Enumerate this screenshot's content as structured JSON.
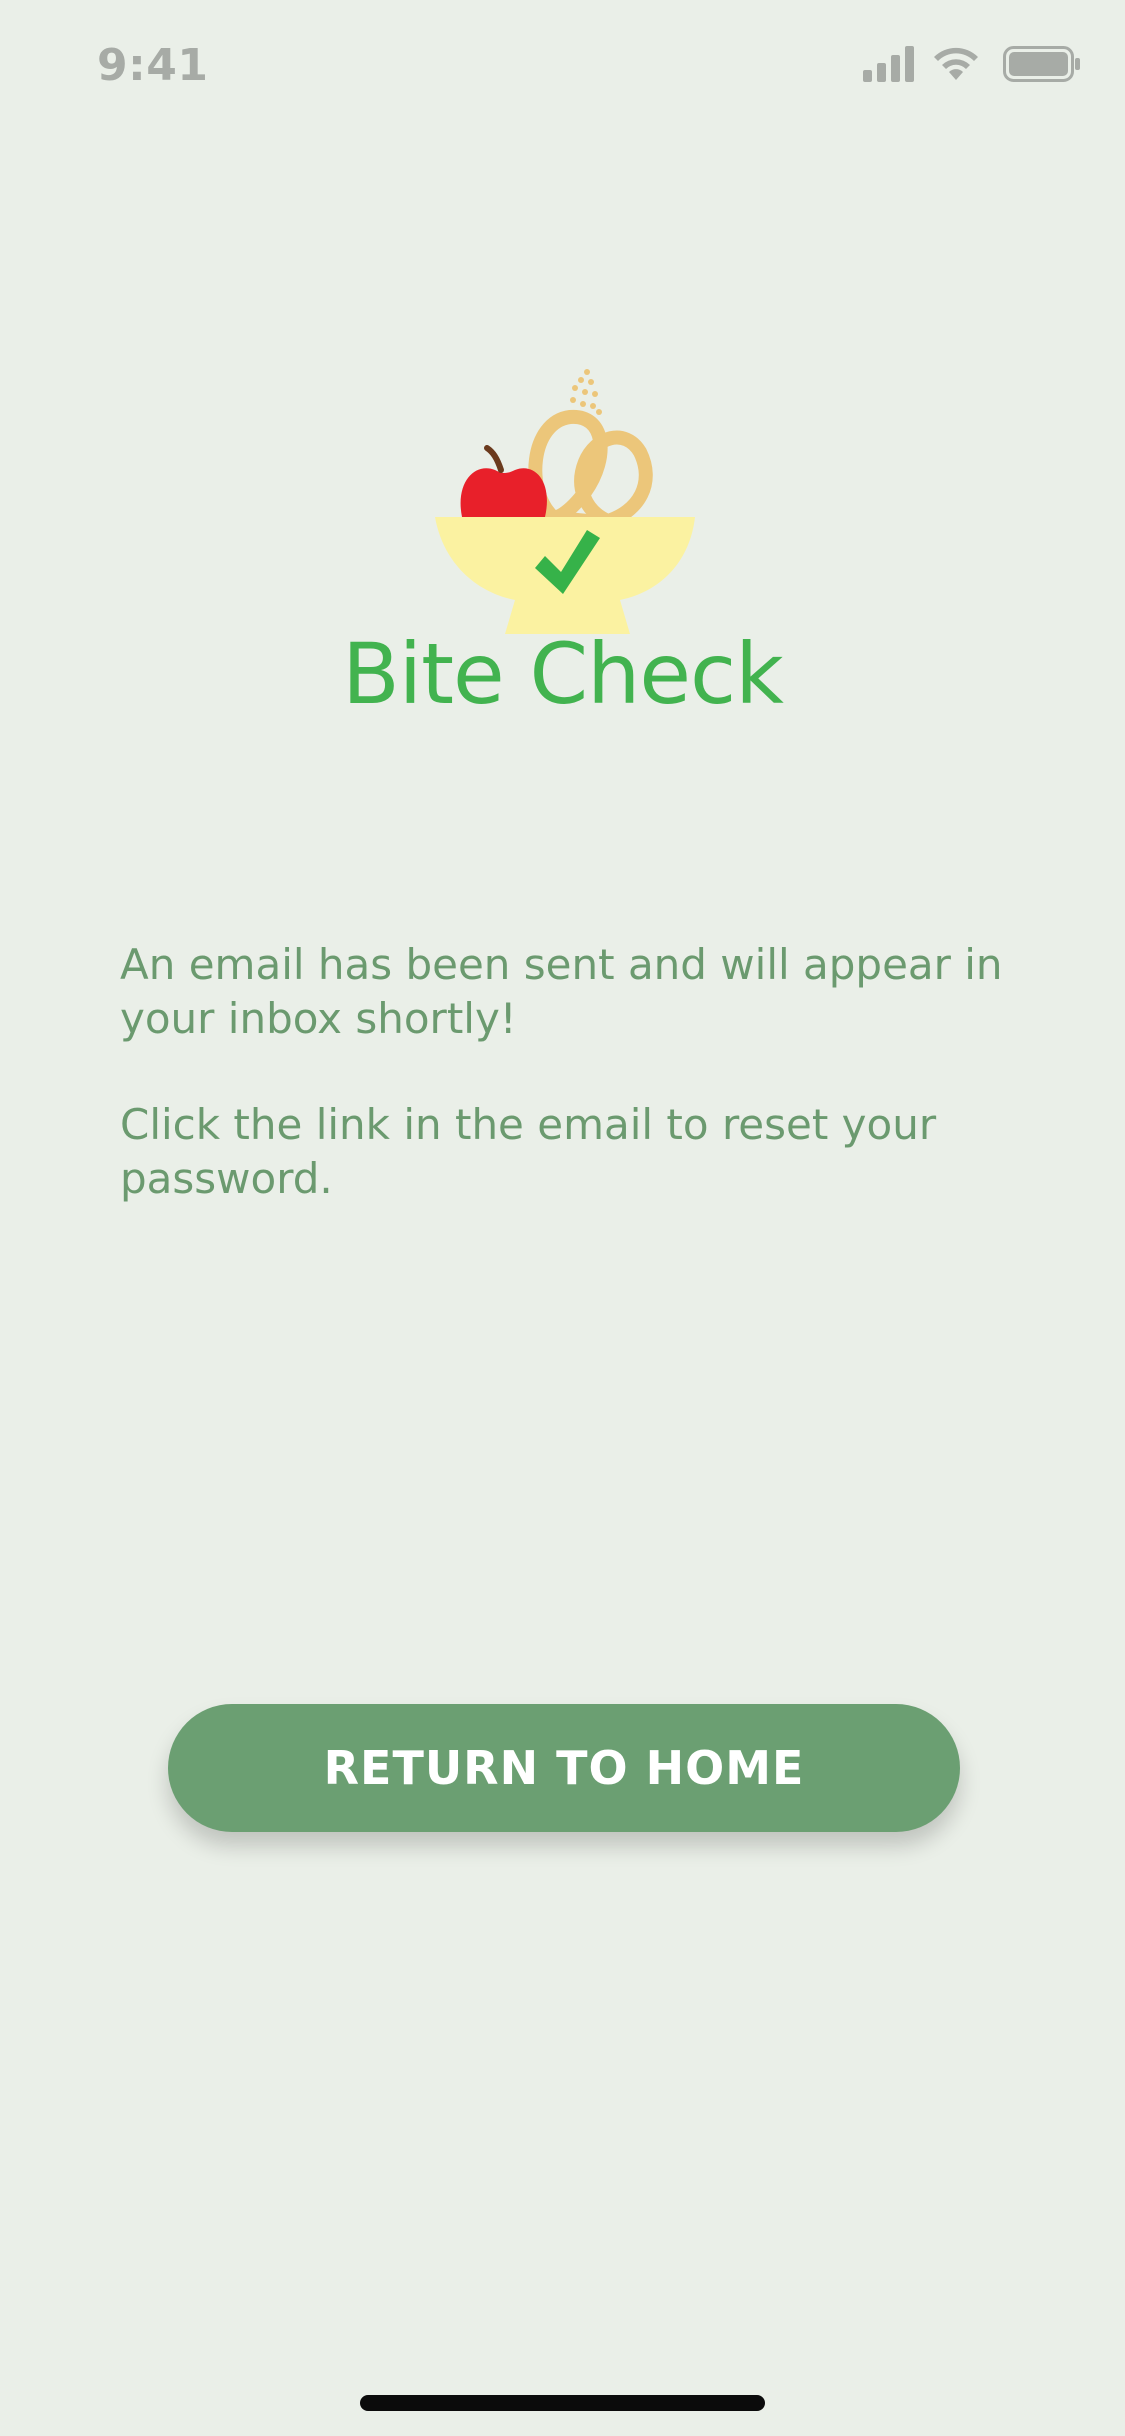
{
  "status_bar": {
    "time": "9:41",
    "icons": [
      "cellular-signal-icon",
      "wifi-icon",
      "battery-icon"
    ]
  },
  "brand": {
    "name": "Bite Check",
    "logo_icon": "food-bowl-checkmark-logo",
    "colors": {
      "brand_green": "#42b34f",
      "apple_red": "#e8202a",
      "bowl_yellow": "#fbf2a1",
      "pretzel_tan": "#ecc67a"
    }
  },
  "message": {
    "line1": "An email has been sent and will appear in your inbox shortly!",
    "line2": "Click the link in the email to reset your password."
  },
  "actions": {
    "return_home_label": "RETURN TO HOME"
  },
  "theme": {
    "background": "#eaefe8",
    "text_green": "#6b9a6f",
    "button_green": "#6b9f72"
  }
}
